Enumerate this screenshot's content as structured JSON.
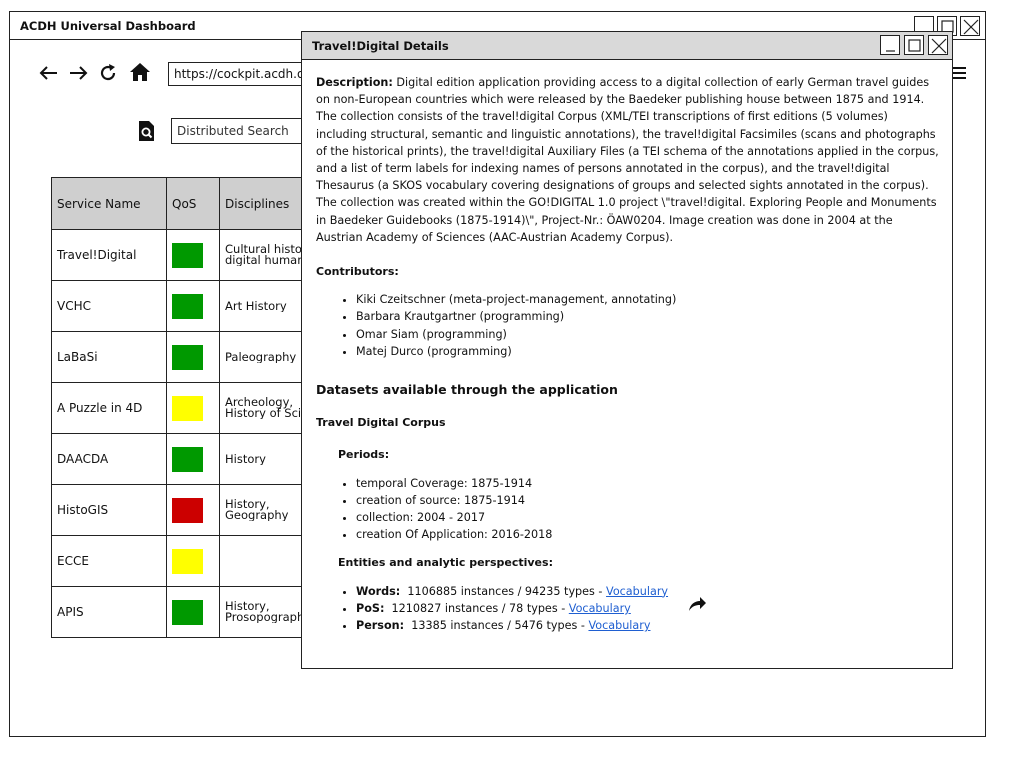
{
  "main_window": {
    "title": "ACDH Universal Dashboard"
  },
  "nav": {
    "back": "←",
    "forward": "→",
    "reload": "⟳",
    "home": "⌂",
    "url": "https://cockpit.acdh.oeaw.ac.at",
    "menu": "☰"
  },
  "search": {
    "placeholder": "Distributed Search"
  },
  "table": {
    "headers": [
      "Service Name",
      "QoS",
      "Disciplines"
    ],
    "rows": [
      {
        "name": "Travel!Digital",
        "qos_color": "#009900",
        "disciplines": "Cultural history, digital humanities"
      },
      {
        "name": "VCHC",
        "qos_color": "#009900",
        "disciplines": "Art History"
      },
      {
        "name": "LaBaSi",
        "qos_color": "#009900",
        "disciplines": "Paleography"
      },
      {
        "name": "A Puzzle in 4D",
        "qos_color": "#ffff00",
        "disciplines": "Archeology, History of Science"
      },
      {
        "name": "DAACDA",
        "qos_color": "#009900",
        "disciplines": "History"
      },
      {
        "name": "HistoGIS",
        "qos_color": "#cc0000",
        "disciplines": "History, Geography"
      },
      {
        "name": "ECCE",
        "qos_color": "#ffff00",
        "disciplines": ""
      },
      {
        "name": "APIS",
        "qos_color": "#009900",
        "disciplines": "History, Prosopography"
      }
    ]
  },
  "dialog": {
    "title": "Travel!Digital Details",
    "description_label": "Description:",
    "description": "Digital edition application providing access to a digital collection of early German travel guides on non-European countries which were released by the Baedeker publishing house between 1875 and 1914. The collection consists of the travel!digital Corpus (XML/TEI transcriptions of first editions (5 volumes) including structural, semantic and linguistic annotations), the travel!digital Facsimiles (scans and photographs of the historical prints), the travel!digital Auxiliary Files (a TEI schema of the annotations applied in the corpus, and a list of term labels for indexing names of persons annotated in the corpus), and the travel!digital Thesaurus (a SKOS vocabulary covering designations of groups and selected sights annotated in the corpus). The collection was created within the GO!DIGITAL 1.0 project \\\"travel!digital. Exploring People and Monuments in Baedeker Guidebooks (1875-1914)\\\", Project-Nr.: ÖAW0204. Image creation was done in 2004 at the Austrian Academy of Sciences (AAC-Austrian Academy Corpus).",
    "contributors_label": "Contributors:",
    "contributors": [
      "Kiki Czeitschner (meta-project-management, annotating)",
      "Barbara Krautgartner (programming)",
      "Omar Siam (programming)",
      "Matej Durco (programming)"
    ],
    "datasets_heading": "Datasets available through the application",
    "corpus_heading": "Travel Digital Corpus",
    "periods_label": "Periods:",
    "periods": [
      "temporal Coverage: 1875-1914",
      "creation of source: 1875-1914",
      "collection: 2004 - 2017",
      "creation Of Application: 2016-2018"
    ],
    "entities_label": "Entities and analytic perspectives:",
    "entities": [
      {
        "label": "Words:",
        "text": "1106885 instances / 94235 types - ",
        "link": "Vocabulary"
      },
      {
        "label": "PoS:",
        "text": "1210827 instances / 78 types - ",
        "link": "Vocabulary"
      },
      {
        "label": "Person:",
        "text": "13385 instances / 5476 types - ",
        "link": "Vocabulary"
      }
    ]
  }
}
